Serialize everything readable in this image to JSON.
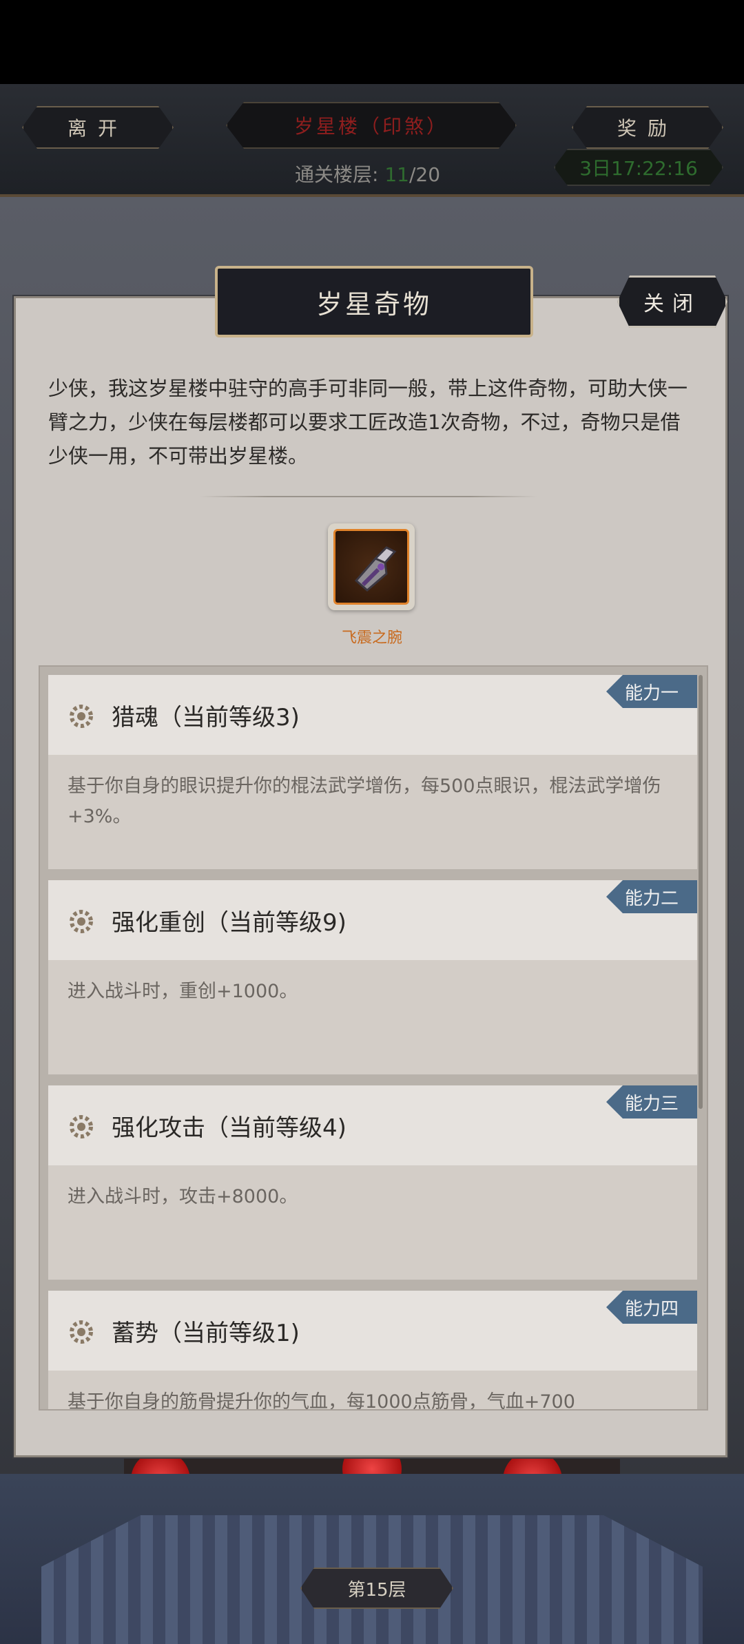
{
  "header": {
    "leave_label": "离开",
    "title": "岁星楼（印煞）",
    "reward_label": "奖励",
    "progress_label": "通关楼层:",
    "progress_current": "11",
    "progress_total": "/20",
    "timer": "3日17:22:16"
  },
  "dialog": {
    "title": "岁星奇物",
    "close_label": "关闭",
    "intro": "少侠，我这岁星楼中驻守的高手可非同一般，带上这件奇物，可助大侠一臂之力，少侠在每层楼都可以要求工匠改造1次奇物，不过，奇物只是借少侠一用，不可带出岁星楼。",
    "item_name": "飞震之腕",
    "item_icon": "bracer-icon"
  },
  "abilities": [
    {
      "tag": "能力一",
      "title": "猎魂（当前等级3)",
      "desc": "基于你自身的眼识提升你的棍法武学增伤，每500点眼识，棍法武学增伤+3%。"
    },
    {
      "tag": "能力二",
      "title": "强化重创（当前等级9)",
      "desc": "进入战斗时，重创+1000。"
    },
    {
      "tag": "能力三",
      "title": "强化攻击（当前等级4)",
      "desc": "进入战斗时，攻击+8000。"
    },
    {
      "tag": "能力四",
      "title": "蓄势（当前等级1)",
      "desc": "基于你自身的筋骨提升你的气血，每1000点筋骨，气血+700"
    }
  ],
  "footer": {
    "floor_label": "第15层"
  }
}
